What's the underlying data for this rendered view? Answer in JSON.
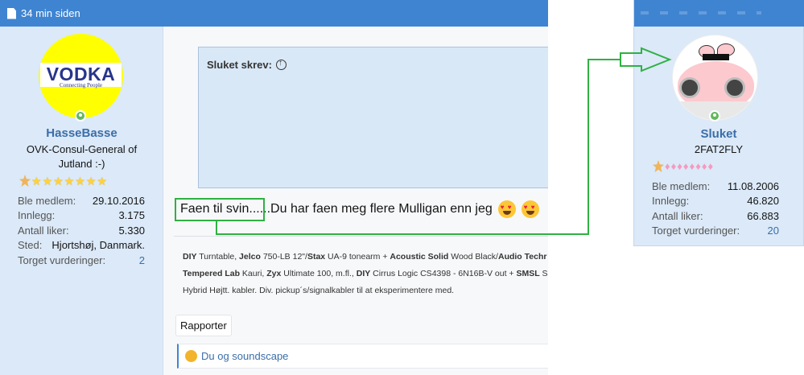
{
  "post": {
    "timestamp": "34 min siden",
    "author": {
      "name": "HasseBasse",
      "title": "OVK-Consul-General of Jutland :-)",
      "avatar_text": "VODKA",
      "avatar_subtext": "Connecting People",
      "stats": [
        {
          "label": "Ble medlem:",
          "value": "29.10.2016"
        },
        {
          "label": "Innlegg:",
          "value": "3.175"
        },
        {
          "label": "Antall liker:",
          "value": "5.330"
        },
        {
          "label": "Sted:",
          "value": "Hjortshøj, Danmark."
        },
        {
          "label": "Torget vurderinger:",
          "value": "2"
        }
      ]
    },
    "quote": {
      "author": "Sluket skrev:"
    },
    "message": {
      "highlight": "Faen til svin......",
      "rest": " Du har faen meg flere Mulligan enn jeg"
    },
    "signature": {
      "line1": [
        {
          "b": "DIY",
          "t": " Turntable, "
        },
        {
          "b": "Jelco",
          "t": " 750-LB 12\"/"
        },
        {
          "b": "Stax",
          "t": " UA-9 tonearm + "
        },
        {
          "b": "Acoustic Solid",
          "t": " Wood Black/"
        },
        {
          "b": "Audio Techr",
          "t": ""
        }
      ],
      "line2": [
        {
          "b": "Tempered Lab",
          "t": " Kauri, "
        },
        {
          "b": "Zyx",
          "t": " Ultimate 100, m.fl., "
        },
        {
          "b": "DIY",
          "t": " Cirrus Logic CS4398 - 6N16B-V out + "
        },
        {
          "b": "SMSL",
          "t": " S"
        }
      ],
      "line3": "Hybrid Højtt. kabler. Div. pickup´s/signalkabler til at eksperimentere med."
    },
    "report_label": "Rapporter",
    "reaction_text": "Du og soundscape"
  },
  "card": {
    "name": "Sluket",
    "title": "2FAT2FLY",
    "stats": [
      {
        "label": "Ble medlem:",
        "value": "11.08.2006"
      },
      {
        "label": "Innlegg:",
        "value": "46.820"
      },
      {
        "label": "Antall liker:",
        "value": "66.883"
      },
      {
        "label": "Torget vurderinger:",
        "value": "20"
      }
    ]
  },
  "colors": {
    "header_blue": "#3f84d1",
    "panel_blue": "#dbe9f8",
    "username": "#3b6ea8",
    "highlight_green": "#2fb142",
    "online_green": "#63b85e"
  },
  "icons": {
    "header": "document-icon",
    "quote": "arrow-up-circle-icon",
    "reaction": "laughing-emoji-icon"
  }
}
